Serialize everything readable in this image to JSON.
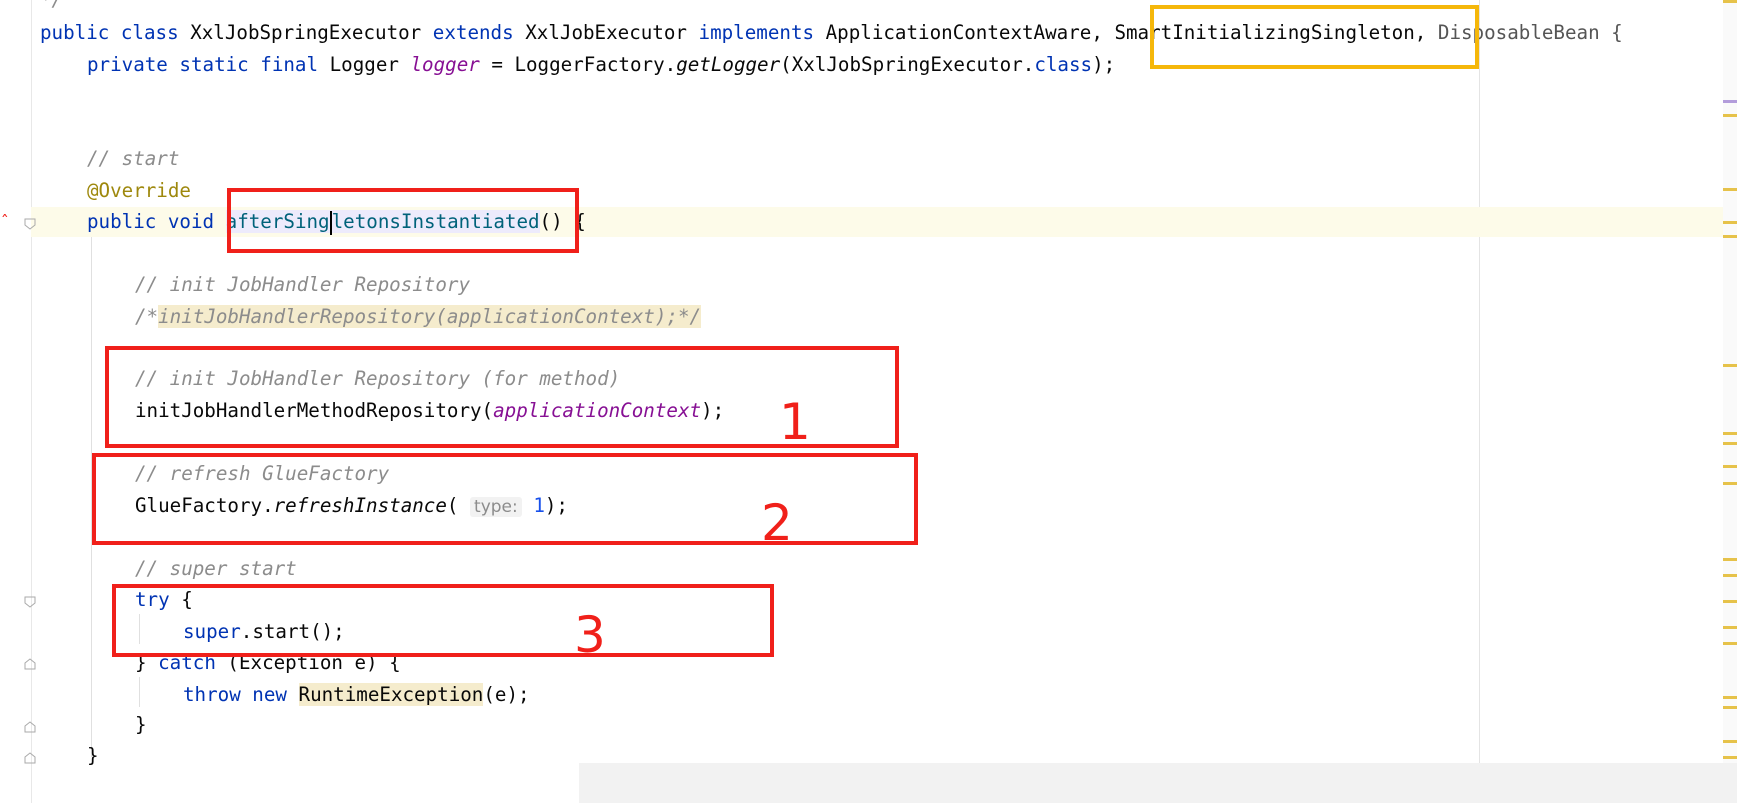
{
  "editor": {
    "lines": {
      "l0": "*/",
      "l1_kw1": "public class",
      "l1_name": "XxlJobSpringExecutor",
      "l1_kw2": "extends",
      "l1_parent": "XxlJobExecutor",
      "l1_kw3": "implements",
      "l1_if1": "ApplicationContextAware,",
      "l1_if2": "SmartInitializingSingleton,",
      "l1_if3": "DisposableBean {",
      "l2_kw": "private static final",
      "l2_type": "Logger",
      "l2_field": "logger",
      "l2_rest1": " = LoggerFactory.",
      "l2_method": "getLogger",
      "l2_rest2": "(XxlJobSpringExecutor.",
      "l2_kw2": "class",
      "l2_rest3": ");",
      "l5": "// start",
      "l6": "@Override",
      "l7_kw": "public void",
      "l7_m1": "afterSing",
      "l7_m2": "letonsInstantiated",
      "l7_rest": "() {",
      "l9": "// init JobHandler Repository",
      "l10_a": "/*",
      "l10_b": "initJobHandlerRepository(applicationContext);*/",
      "l12": "// init JobHandler Repository (for method)",
      "l13_a": "initJobHandlerMethodRepository(",
      "l13_b": "applicationContext",
      "l13_c": ");",
      "l15": "// refresh GlueFactory",
      "l16_a": "GlueFactory.",
      "l16_b": "refreshInstance",
      "l16_c": "(",
      "l16_hint": "type:",
      "l16_num": "1",
      "l16_d": ");",
      "l18": "// super start",
      "l19_kw": "try",
      "l19_rest": " {",
      "l20_kw": "super",
      "l20_rest": ".start();",
      "l21_a": "} ",
      "l21_kw": "catch",
      "l21_b": " (Exception e) {",
      "l22_kw": "throw new",
      "l22_cls": "RuntimeException",
      "l22_rest": "(e);",
      "l23": "}",
      "l24": "}"
    }
  },
  "annotations": {
    "n1": "1",
    "n2": "2",
    "n3": "3"
  },
  "colors": {
    "keyword": "#0033b3",
    "comment": "#8c8c8c",
    "annotation": "#9e880d",
    "field": "#871094",
    "number": "#1750eb",
    "red_box": "#f0201a",
    "yellow_box": "#f5b70a"
  }
}
